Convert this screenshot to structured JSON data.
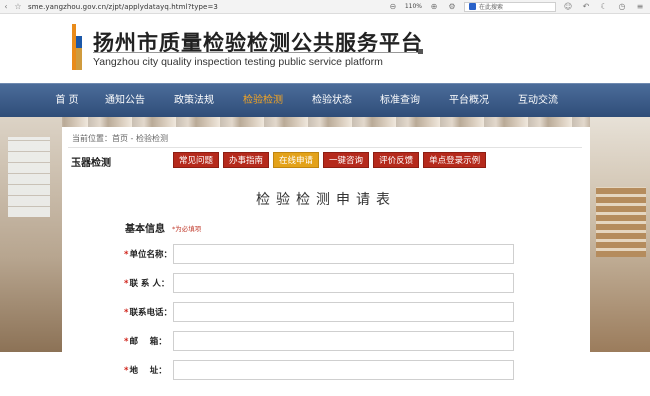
{
  "browser": {
    "url": "sme.yangzhou.gov.cn/zjpt/applydatayq.html?type=3",
    "zoom": "110%",
    "search_placeholder": "在此搜索"
  },
  "site": {
    "title": "扬州市质量检验检测公共服务平台",
    "subtitle": "Yangzhou city quality inspection testing public service platform",
    "colors": {
      "logo_orange": "#e98b1a",
      "logo_blue": "#1c58a8",
      "nav_bg": "#3a5a86",
      "nav_active": "#f5a623",
      "tab_red": "#b52a1c",
      "tab_active": "#e3a21a",
      "required": "#d0241b"
    }
  },
  "nav": {
    "items": [
      {
        "label": "首 页"
      },
      {
        "label": "通知公告"
      },
      {
        "label": "政策法规"
      },
      {
        "label": "检验检测",
        "active": true
      },
      {
        "label": "检验状态"
      },
      {
        "label": "标准查询"
      },
      {
        "label": "平台概况"
      },
      {
        "label": "互动交流"
      }
    ]
  },
  "content": {
    "breadcrumb": "当前位置：首页 - 检验检测",
    "section_name": "玉器检测",
    "tabs": [
      {
        "label": "常见问题"
      },
      {
        "label": "办事指南"
      },
      {
        "label": "在线申请",
        "active": true
      },
      {
        "label": "一键咨询"
      },
      {
        "label": "评价反馈"
      },
      {
        "label": "单点登录示例"
      }
    ],
    "form_title": "检验检测申请表",
    "basic_info": "基本信息",
    "required_note": "*为必填项",
    "fields": [
      {
        "star": "*",
        "label": "单位名称：",
        "value": ""
      },
      {
        "star": "*",
        "label": "联 系 人：",
        "value": ""
      },
      {
        "star": "*",
        "label": "联系电话：",
        "value": ""
      },
      {
        "star": "*",
        "label": "邮    箱：",
        "value": ""
      },
      {
        "star": "*",
        "label": "地    址：",
        "value": ""
      }
    ]
  }
}
